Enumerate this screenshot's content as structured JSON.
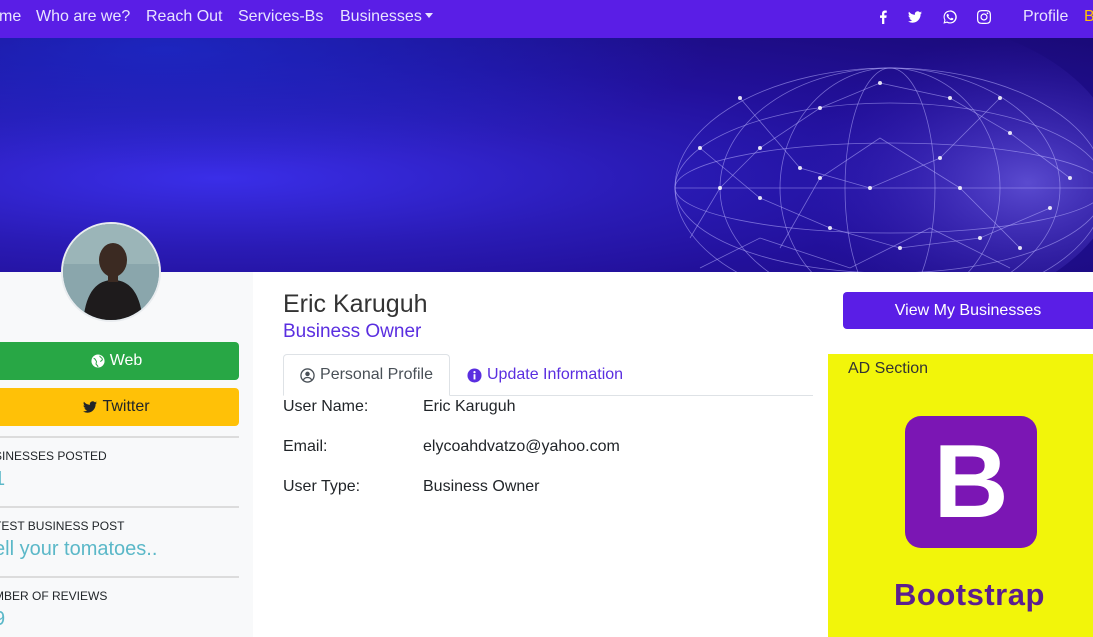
{
  "nav": {
    "links": [
      "me",
      "Who are we?",
      "Reach Out",
      "Services-Bs",
      "Businesses"
    ],
    "profile": "Profile",
    "cut_item": "B",
    "social_icons": [
      "facebook-icon",
      "twitter-icon",
      "whatsapp-icon",
      "instagram-icon"
    ]
  },
  "colors": {
    "brand": "#5a1ee6",
    "web_button": "#28a745",
    "twitter_button": "#ffc107",
    "stat_value": "#5bb8c8",
    "ad_bg": "#f2f50a"
  },
  "sidebar": {
    "web_label": "Web",
    "twitter_label": "Twitter",
    "stats": [
      {
        "label": "SINESSES POSTED",
        "value": "1"
      },
      {
        "label": "TEST BUSINESS POST",
        "value": "ell your tomatoes.."
      },
      {
        "label": "MBER OF REVIEWS",
        "value": "9"
      }
    ]
  },
  "profile": {
    "name": "Eric Karuguh",
    "role": "Business Owner",
    "tabs": [
      "Personal Profile",
      "Update Information"
    ],
    "fields": [
      {
        "label": "User Name:",
        "value": "Eric Karuguh"
      },
      {
        "label": "Email:",
        "value": "elycoahdvatzo@yahoo.com"
      },
      {
        "label": "User Type:",
        "value": "Business Owner"
      }
    ]
  },
  "right": {
    "view_button": "View My Businesses",
    "ad_title": "AD Section",
    "ad_logo_letter": "B",
    "ad_logo_word": "Bootstrap"
  }
}
